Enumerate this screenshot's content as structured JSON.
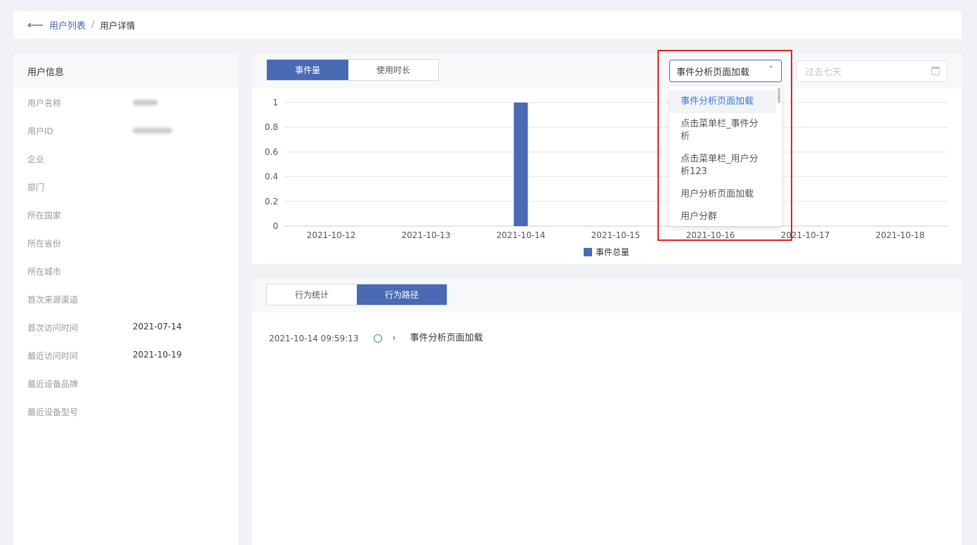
{
  "breadcrumb": {
    "parent": "用户列表",
    "separator": "/",
    "current": "用户详情"
  },
  "user_info": {
    "title": "用户信息",
    "rows": [
      {
        "label": "用户名称",
        "value": ""
      },
      {
        "label": "用户ID",
        "value": ""
      },
      {
        "label": "企业",
        "value": ""
      },
      {
        "label": "部门",
        "value": ""
      },
      {
        "label": "所在国家",
        "value": ""
      },
      {
        "label": "所在省份",
        "value": ""
      },
      {
        "label": "所在城市",
        "value": ""
      },
      {
        "label": "首次来源渠道",
        "value": ""
      },
      {
        "label": "首次访问时间",
        "value": "2021-07-14"
      },
      {
        "label": "最近访问时间",
        "value": "2021-10-19"
      },
      {
        "label": "最近设备品牌",
        "value": ""
      },
      {
        "label": "最近设备型号",
        "value": ""
      }
    ]
  },
  "chart_tabs": {
    "tab1": "事件量",
    "tab2": "使用时长"
  },
  "event_select": {
    "value": "事件分析页面加载",
    "options": [
      "事件分析页面加载",
      "点击菜单栏_事件分析",
      "点击菜单栏_用户分析123",
      "用户分析页面加载",
      "用户分群"
    ]
  },
  "date_picker": {
    "placeholder": "过去七天"
  },
  "colors": {
    "accent": "#4a6bb4",
    "bar": "#4a6bb4",
    "highlight": "#e02020"
  },
  "chart_data": {
    "type": "bar",
    "categories": [
      "2021-10-12",
      "2021-10-13",
      "2021-10-14",
      "2021-10-15",
      "2021-10-16",
      "2021-10-17",
      "2021-10-18"
    ],
    "series": [
      {
        "name": "事件总量",
        "values": [
          0,
          0,
          1,
          0,
          0,
          0,
          0
        ]
      }
    ],
    "yticks": [
      "0",
      "0.2",
      "0.4",
      "0.6",
      "0.8",
      "1"
    ],
    "ylim": [
      0,
      1
    ],
    "legend": "bottom",
    "grid": true
  },
  "path_tabs": {
    "tab1": "行为统计",
    "tab2": "行为路径"
  },
  "path": [
    {
      "time": "2021-10-14 09:59:13",
      "event": "事件分析页面加载"
    }
  ]
}
